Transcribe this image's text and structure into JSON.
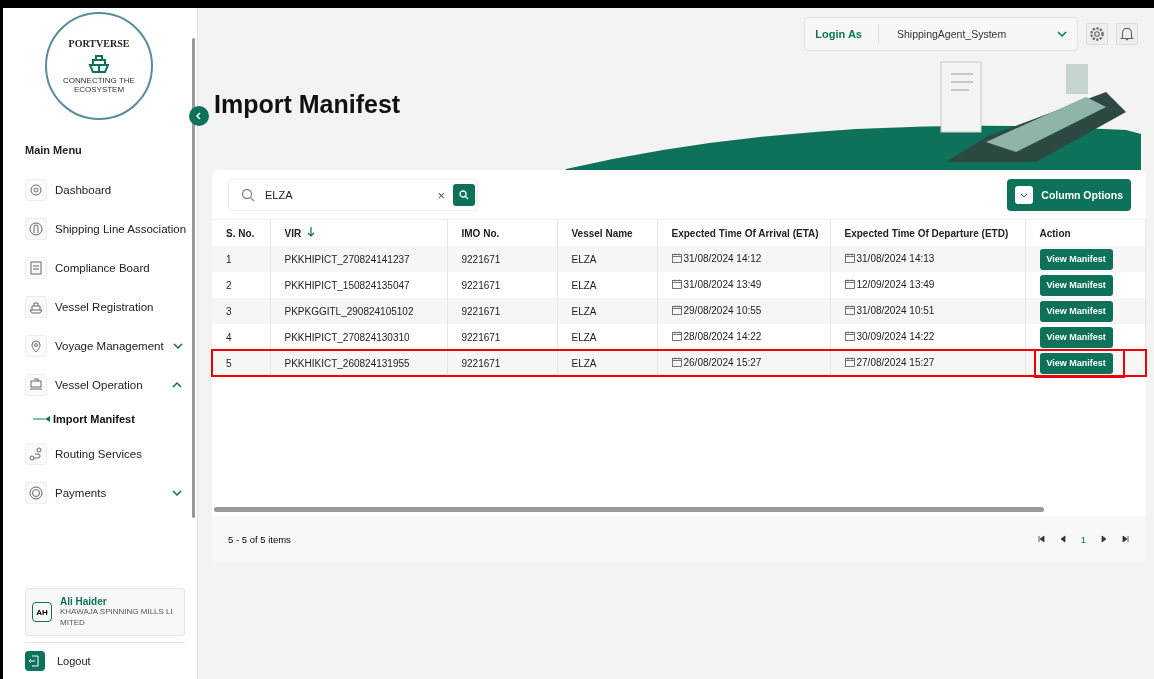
{
  "logo": {
    "name": "PORTVERSE",
    "tagline": "CONNECTING THE ECOSYSTEM"
  },
  "sidebar": {
    "heading": "Main Menu",
    "items": [
      {
        "label": "Dashboard",
        "kind": "dashboard"
      },
      {
        "label": "Shipping Line Association",
        "kind": "association"
      },
      {
        "label": "Compliance Board",
        "kind": "document"
      },
      {
        "label": "Vessel Registration",
        "kind": "ship"
      },
      {
        "label": "Voyage Management",
        "kind": "pin",
        "expanded": false
      },
      {
        "label": "Vessel Operation",
        "kind": "cargo",
        "expanded": true,
        "children": [
          {
            "label": "Import Manifest",
            "selected": true
          }
        ]
      },
      {
        "label": "Routing Services",
        "kind": "route"
      },
      {
        "label": "Payments",
        "kind": "coin",
        "expanded": false
      }
    ]
  },
  "user": {
    "initials": "AH",
    "name": "Ali Haider",
    "company": "KHAWAJA SPINNING MILLS LI MITED"
  },
  "logout": "Logout",
  "topbar": {
    "login_label": "Login As",
    "role": "ShippingAgent_System"
  },
  "page_title": "Import Manifest",
  "search": {
    "value": "ELZA",
    "clear": "×"
  },
  "column_options": "Column Options",
  "table": {
    "columns": [
      {
        "label": "S. No.",
        "sorted": false
      },
      {
        "label": "VIR",
        "sorted": true
      },
      {
        "label": "IMO No.",
        "sorted": false
      },
      {
        "label": "Vessel Name",
        "sorted": false
      },
      {
        "label": "Expected Time Of Arrival (ETA)",
        "sorted": false
      },
      {
        "label": "Expected Time Of Departure (ETD)",
        "sorted": false
      },
      {
        "label": "Action",
        "sorted": false
      }
    ],
    "rows": [
      {
        "no": "1",
        "vir": "PKKHIPICT_270824141237",
        "imo": "9221671",
        "vessel": "ELZA",
        "eta": "31/08/2024 14:12",
        "etd": "31/08/2024 14:13",
        "action": "View Manifest",
        "highlighted": false
      },
      {
        "no": "2",
        "vir": "PKKHIPICT_150824135047",
        "imo": "9221671",
        "vessel": "ELZA",
        "eta": "31/08/2024 13:49",
        "etd": "12/09/2024 13:49",
        "action": "View Manifest",
        "highlighted": false
      },
      {
        "no": "3",
        "vir": "PKPKGGITL_290824105102",
        "imo": "9221671",
        "vessel": "ELZA",
        "eta": "29/08/2024 10:55",
        "etd": "31/08/2024 10:51",
        "action": "View Manifest",
        "highlighted": false
      },
      {
        "no": "4",
        "vir": "PKKHIPICT_270824130310",
        "imo": "9221671",
        "vessel": "ELZA",
        "eta": "28/08/2024 14:22",
        "etd": "30/09/2024 14:22",
        "action": "View Manifest",
        "highlighted": false
      },
      {
        "no": "5",
        "vir": "PKKHIKICT_260824131955",
        "imo": "9221671",
        "vessel": "ELZA",
        "eta": "26/08/2024 15:27",
        "etd": "27/08/2024 15:27",
        "action": "View Manifest",
        "highlighted": true
      }
    ]
  },
  "pager": {
    "summary": "5 - 5 of 5 items",
    "pages": [
      {
        "label": "1",
        "selected": true
      }
    ]
  }
}
